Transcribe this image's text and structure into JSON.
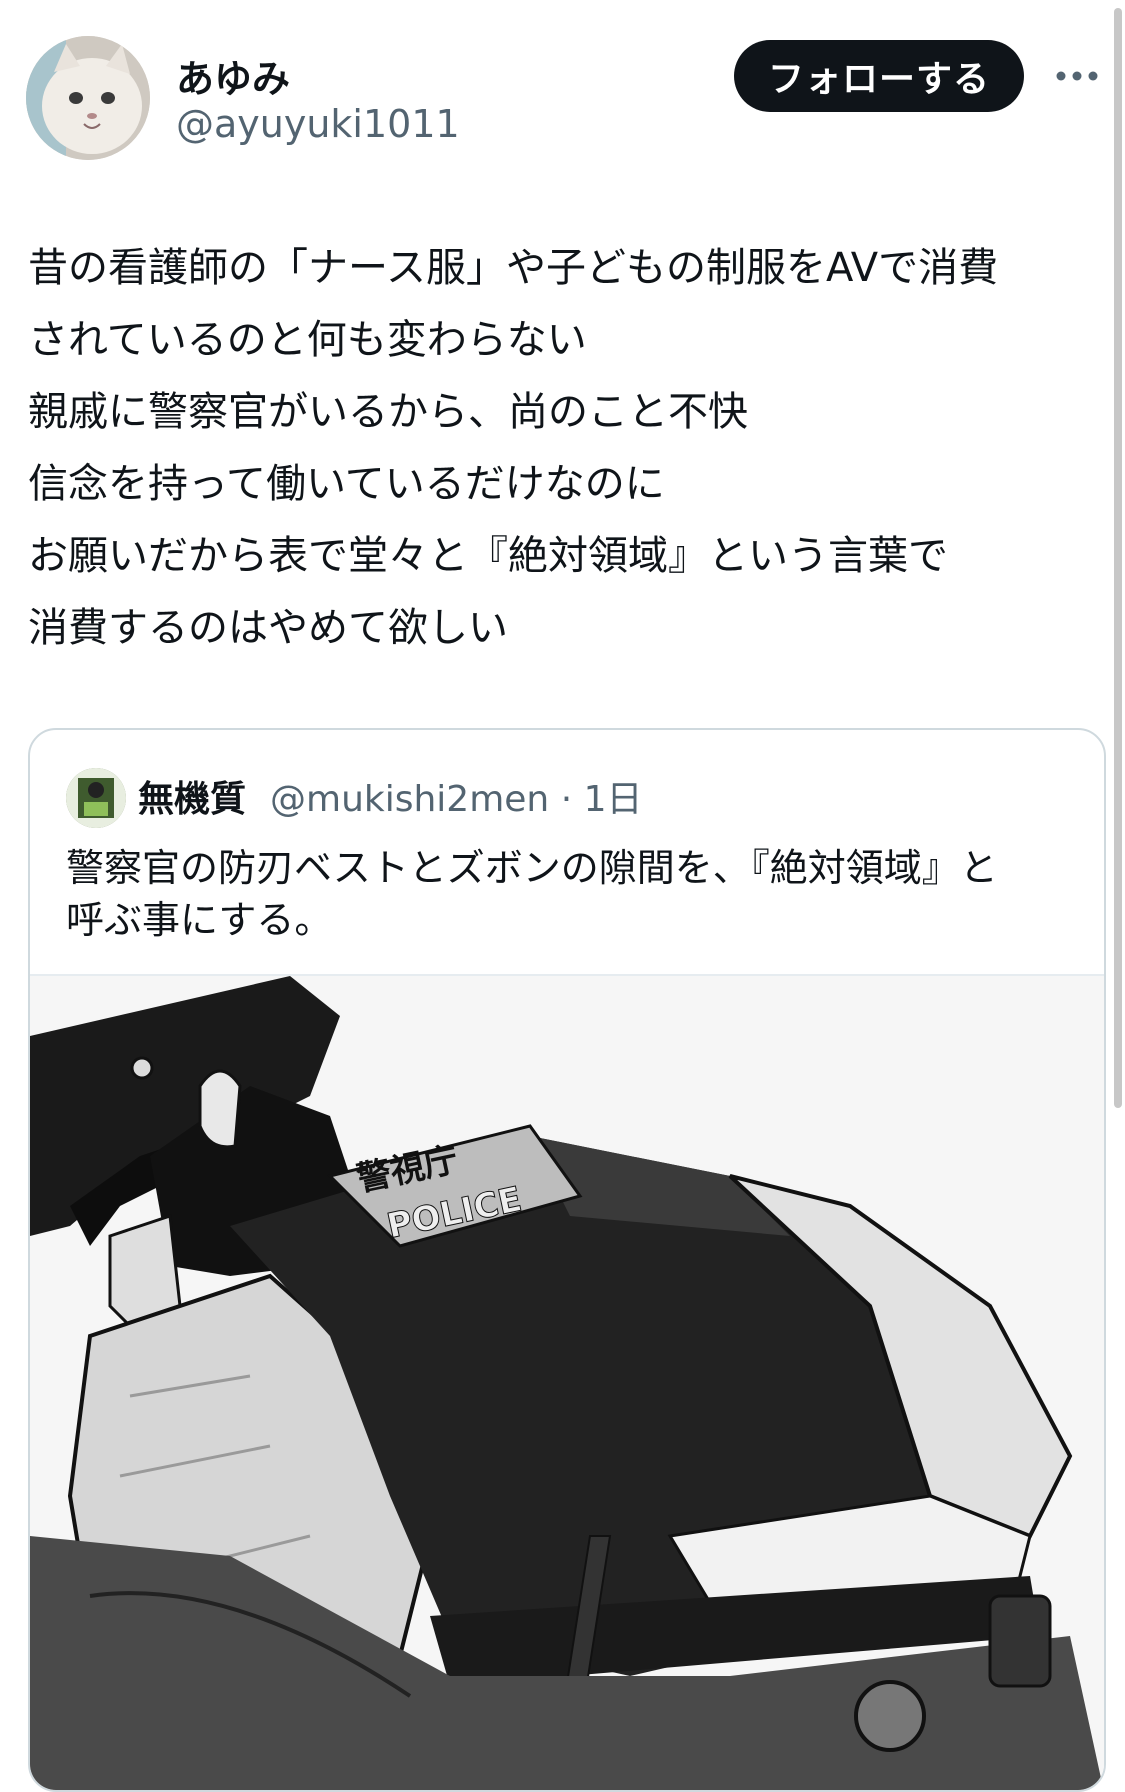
{
  "author": {
    "display_name": "あゆみ",
    "handle": "@ayuyuki1011"
  },
  "follow_button": {
    "label": "フォローする"
  },
  "more_icon": "more-horizontal-icon",
  "tweet": {
    "lines": [
      "昔の看護師の「ナース服」や子どもの制服をAVで消費",
      "されているのと何も変わらない",
      "親戚に警察官がいるから、尚のこと不快",
      "信念を持って働いているだけなのに",
      "お願いだから表で堂々と『絶対領域』という言葉で",
      "消費するのはやめて欲しい"
    ]
  },
  "quoted_tweet": {
    "display_name": "無機質",
    "handle": "@mukishi2men",
    "time": "· 1日",
    "lines": [
      "警察官の防刃ベストとズボンの隙間を、『絶対領域』と",
      "呼ぶ事にする。"
    ],
    "image": {
      "vest_text_kanji": "警視庁",
      "vest_text_latin": "POLICE"
    }
  },
  "colors": {
    "text": "#0f1419",
    "secondary": "#536471",
    "button_bg": "#0f1419",
    "border": "#cfd9de"
  }
}
